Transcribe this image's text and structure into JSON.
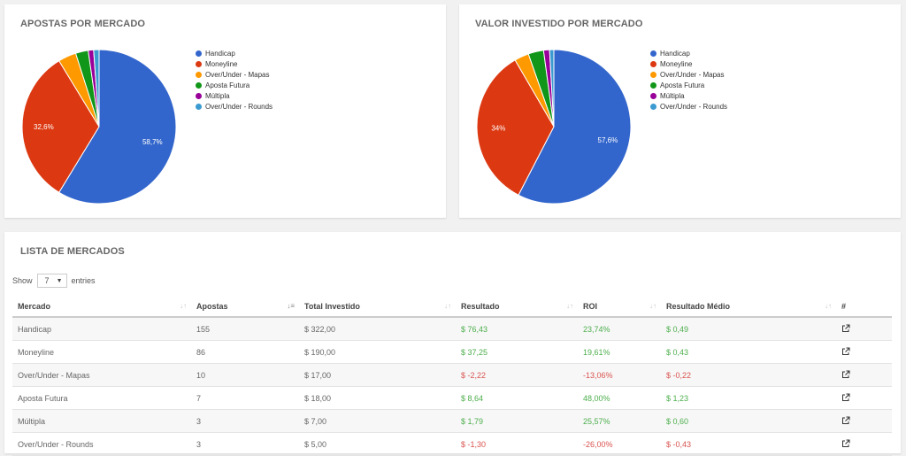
{
  "colors": {
    "handicap": "#3366cc",
    "moneyline": "#dc3912",
    "over_under_mapas": "#ff9900",
    "aposta_futura": "#109618",
    "multipla": "#990099",
    "over_under_rounds": "#3b9bd1",
    "positive": "#4cae4c",
    "negative": "#d9534f"
  },
  "charts": {
    "apostas": {
      "title": "APOSTAS POR MERCADO",
      "legend": [
        "Handicap",
        "Moneyline",
        "Over/Under - Mapas",
        "Aposta Futura",
        "Múltipla",
        "Over/Under - Rounds"
      ]
    },
    "valor": {
      "title": "VALOR INVESTIDO POR MERCADO",
      "legend": [
        "Handicap",
        "Moneyline",
        "Over/Under - Mapas",
        "Aposta Futura",
        "Múltipla",
        "Over/Under - Rounds"
      ]
    }
  },
  "chart_data": [
    {
      "type": "pie",
      "title": "APOSTAS POR MERCADO",
      "categories": [
        "Handicap",
        "Moneyline",
        "Over/Under - Mapas",
        "Aposta Futura",
        "Múltipla",
        "Over/Under - Rounds"
      ],
      "values": [
        155,
        86,
        10,
        7,
        3,
        3
      ],
      "slice_labels": [
        "58,7%",
        "32,6%",
        "",
        "",
        "",
        ""
      ],
      "legend_position": "right"
    },
    {
      "type": "pie",
      "title": "VALOR INVESTIDO POR MERCADO",
      "categories": [
        "Handicap",
        "Moneyline",
        "Over/Under - Mapas",
        "Aposta Futura",
        "Múltipla",
        "Over/Under - Rounds"
      ],
      "values": [
        322.0,
        190.0,
        17.0,
        18.0,
        7.0,
        5.0
      ],
      "slice_labels": [
        "57,6%",
        "34%",
        "",
        "",
        "",
        ""
      ],
      "legend_position": "right"
    }
  ],
  "lista": {
    "title": "LISTA DE MERCADOS",
    "show_label": "Show",
    "entries_value": "7",
    "entries_label": "entries",
    "columns": [
      "Mercado",
      "Apostas",
      "Total Investido",
      "Resultado",
      "ROI",
      "Resultado Médio",
      "#"
    ],
    "rows": [
      {
        "mercado": "Handicap",
        "apostas": "155",
        "total": "$ 322,00",
        "resultado": "$ 76,43",
        "roi": "23,74%",
        "medio": "$ 0,49",
        "sign": "pos"
      },
      {
        "mercado": "Moneyline",
        "apostas": "86",
        "total": "$ 190,00",
        "resultado": "$ 37,25",
        "roi": "19,61%",
        "medio": "$ 0,43",
        "sign": "pos"
      },
      {
        "mercado": "Over/Under - Mapas",
        "apostas": "10",
        "total": "$ 17,00",
        "resultado": "$ -2,22",
        "roi": "-13,06%",
        "medio": "$ -0,22",
        "sign": "neg"
      },
      {
        "mercado": "Aposta Futura",
        "apostas": "7",
        "total": "$ 18,00",
        "resultado": "$ 8,64",
        "roi": "48,00%",
        "medio": "$ 1,23",
        "sign": "pos"
      },
      {
        "mercado": "Múltipla",
        "apostas": "3",
        "total": "$ 7,00",
        "resultado": "$ 1,79",
        "roi": "25,57%",
        "medio": "$ 0,60",
        "sign": "pos"
      },
      {
        "mercado": "Over/Under - Rounds",
        "apostas": "3",
        "total": "$ 5,00",
        "resultado": "$ -1,30",
        "roi": "-26,00%",
        "medio": "$ -0,43",
        "sign": "neg"
      }
    ]
  }
}
